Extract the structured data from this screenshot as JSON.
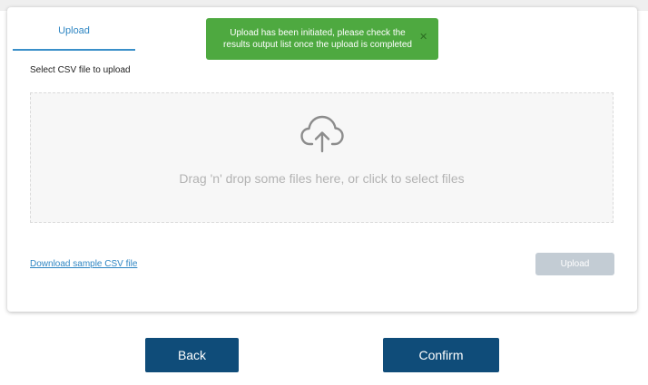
{
  "tabs": [
    {
      "label": "Upload",
      "active": true
    }
  ],
  "form": {
    "select_label": "Select CSV file to upload",
    "dropzone_text": "Drag 'n' drop some files here, or click to select files",
    "dropzone_icon": "cloud-upload-icon",
    "download_link": "Download sample CSV file",
    "upload_button": "Upload",
    "upload_button_state": "disabled"
  },
  "toast": {
    "line1": "Upload has been initiated, please check the",
    "line2": "results output list once the upload is completed",
    "close_icon": "close-icon",
    "color": "#4ea940"
  },
  "footer": {
    "back_label": "Back",
    "confirm_label": "Confirm",
    "button_color": "#0f4c79"
  },
  "colors": {
    "accent": "#2f86c3",
    "upload_disabled": "#c3ccd4"
  }
}
